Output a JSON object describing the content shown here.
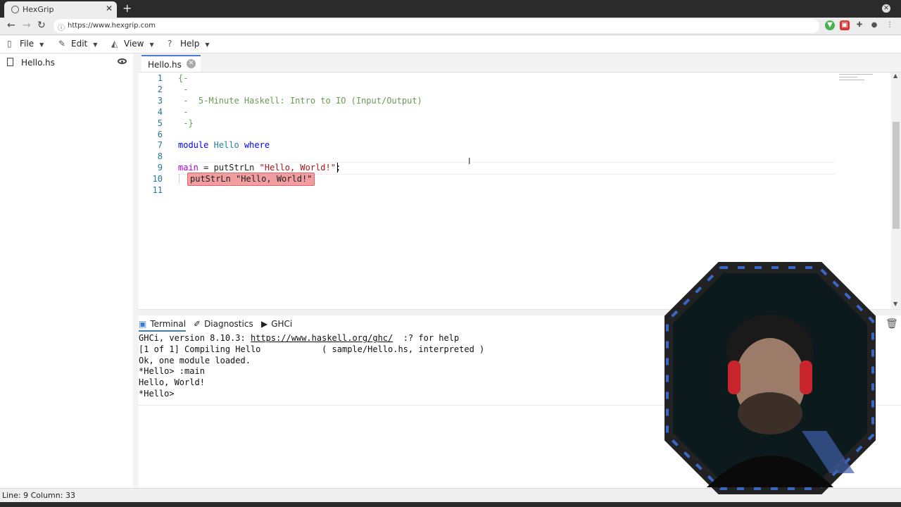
{
  "browser": {
    "tab_title": "HexGrip",
    "tab_close": "✕",
    "new_tab": "+",
    "url": "https://www.hexgrip.com",
    "nav": {
      "back": "←",
      "forward": "→",
      "reload": "↻"
    }
  },
  "menu": {
    "items": [
      {
        "label": "File"
      },
      {
        "label": "Edit"
      },
      {
        "label": "View"
      },
      {
        "label": "Help"
      }
    ]
  },
  "sidebar": {
    "file": "Hello.hs"
  },
  "editor": {
    "tab": "Hello.hs",
    "lines": [
      {
        "n": "1",
        "text": "{-"
      },
      {
        "n": "2",
        "text": " -"
      },
      {
        "n": "3",
        "text": " -  5-Minute Haskell: Intro to IO (Input/Output)"
      },
      {
        "n": "4",
        "text": " -"
      },
      {
        "n": "5",
        "text": " -}"
      },
      {
        "n": "6",
        "text": ""
      },
      {
        "n": "7",
        "module": "module",
        "name": "Hello",
        "where": "where"
      },
      {
        "n": "8",
        "text": ""
      },
      {
        "n": "9",
        "main": "main",
        "eq": " = ",
        "fn": "putStrLn",
        "str": " \"Hello, World!\"",
        "semi": ";"
      },
      {
        "n": "10",
        "text": ""
      },
      {
        "n": "11",
        "text": ""
      }
    ],
    "hint": "putStrLn \"Hello, World!\""
  },
  "panel": {
    "tabs": [
      {
        "label": "Terminal",
        "active": true
      },
      {
        "label": "Diagnostics",
        "active": false
      },
      {
        "label": "GHCi",
        "active": false
      }
    ],
    "terminal": {
      "line1_pre": "GHCi, version 8.10.3: ",
      "line1_link": "https://www.haskell.org/ghc/",
      "line1_post": "  :? for help",
      "line2": "[1 of 1] Compiling Hello            ( sample/Hello.hs, interpreted )",
      "line3": "Ok, one module loaded.",
      "line4": "*Hello> :main",
      "line5": "Hello, World!",
      "line6": "*Hello> "
    }
  },
  "status": {
    "position": "Line: 9 Column: 33"
  },
  "colors": {
    "accent": "#3b7bd0",
    "hint_bg": "#f29da0",
    "comment": "#6a9955",
    "keyword": "#af00db"
  }
}
